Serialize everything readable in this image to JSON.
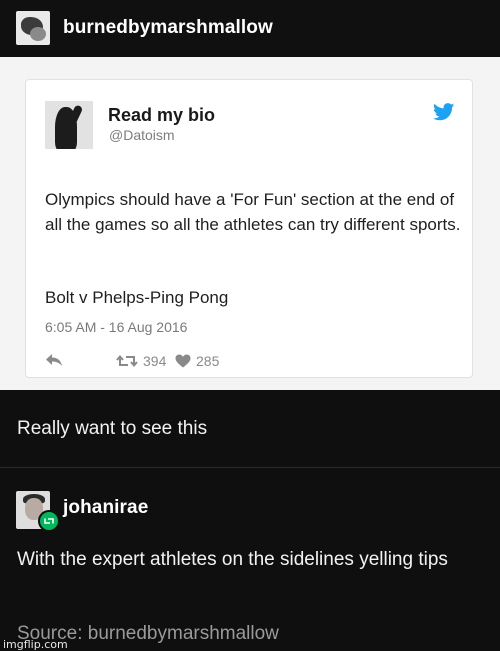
{
  "post": {
    "username": "burnedbymarshmallow",
    "avatar_icon": "blog-avatar-icon"
  },
  "tweet": {
    "name": "Read my bio",
    "handle": "@Datoism",
    "text": "Olympics should have a 'For Fun' section at the end of all the games so all the athletes can try different sports.",
    "text2": "Bolt v Phelps-Ping Pong",
    "time": "6:05 AM - 16 Aug 2016",
    "retweets": "394",
    "likes": "285",
    "icons": [
      "twitter-bird-icon",
      "reply-icon",
      "retweet-icon",
      "heart-icon"
    ],
    "accent_color": "#1da1f2"
  },
  "caption": "Really want to see this",
  "reblog": {
    "username": "johanirae",
    "text": "With the expert athletes on the sidelines yelling tips",
    "badge_color": "#00b85c"
  },
  "source": {
    "label": "Source:",
    "name": "burnedbymarshmallow"
  },
  "watermark": "imgflip.com"
}
